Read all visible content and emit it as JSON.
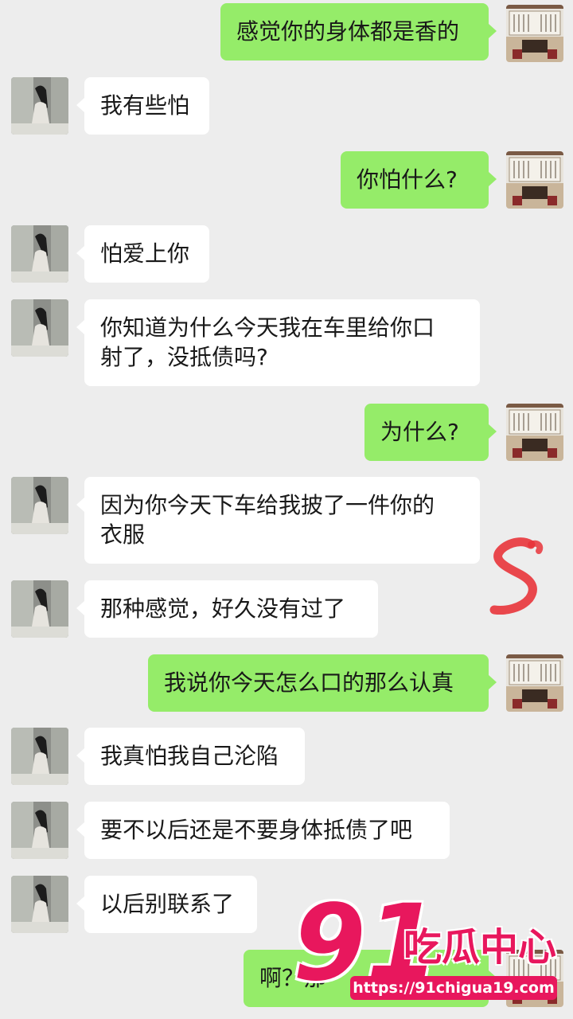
{
  "messages": [
    {
      "side": "right",
      "text": "感觉你的身体都是香的"
    },
    {
      "side": "left",
      "text": "我有些怕"
    },
    {
      "side": "right",
      "text": "你怕什么?"
    },
    {
      "side": "left",
      "text": "怕爱上你"
    },
    {
      "side": "left",
      "text": "你知道为什么今天我在车里给你口\n射了，没抵债吗?"
    },
    {
      "side": "right",
      "text": "为什么?"
    },
    {
      "side": "left",
      "text": "因为你今天下车给我披了一件你的\n衣服"
    },
    {
      "side": "left",
      "text": "那种感觉，好久没有过了"
    },
    {
      "side": "right",
      "text": "我说你今天怎么口的那么认真"
    },
    {
      "side": "left",
      "text": "我真怕我自己沦陷"
    },
    {
      "side": "left",
      "text": "要不以后还是不要身体抵债了吧"
    },
    {
      "side": "left",
      "text": "以后别联系了"
    },
    {
      "side": "right",
      "text": "啊？那"
    }
  ],
  "watermark": {
    "number": "91",
    "brand": "吃瓜中心",
    "url": "https://91chigua19.com"
  },
  "colors": {
    "background": "#ededed",
    "sent_bubble": "#95ec69",
    "received_bubble": "#ffffff",
    "watermark": "#e8175d",
    "annotation": "#e8343a"
  },
  "icons": {
    "left_avatar": "woman-photo-avatar",
    "right_avatar": "calligraphy-hall-avatar",
    "annotation": "red-squiggle-mark"
  }
}
